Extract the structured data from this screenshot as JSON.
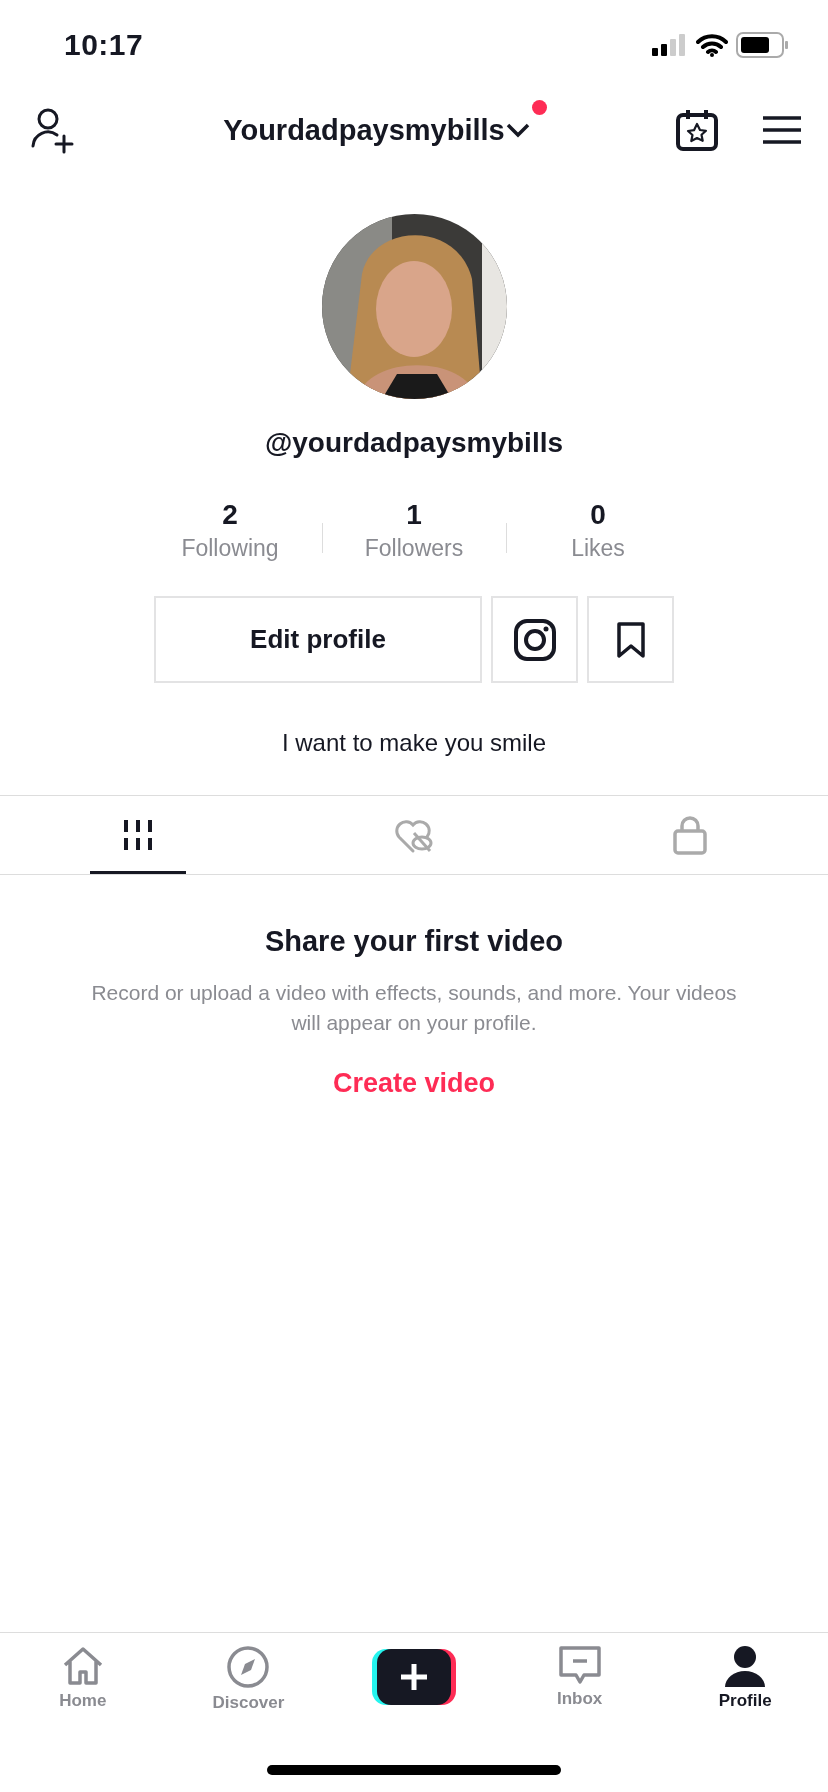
{
  "status_bar": {
    "time": "10:17"
  },
  "header": {
    "username": "Yourdadpaysmybills",
    "notification_dot": true
  },
  "profile": {
    "handle": "@yourdadpaysmybills",
    "stats": [
      {
        "value": "2",
        "label": "Following"
      },
      {
        "value": "1",
        "label": "Followers"
      },
      {
        "value": "0",
        "label": "Likes"
      }
    ],
    "edit_button": "Edit profile",
    "bio": "I want to make you smile"
  },
  "tabs": [
    {
      "kind": "videos",
      "selected": true
    },
    {
      "kind": "liked",
      "selected": false
    },
    {
      "kind": "private",
      "selected": false
    }
  ],
  "empty_state": {
    "title": "Share your first video",
    "text": "Record or upload a video with effects, sounds, and more. Your videos will appear on your profile.",
    "link": "Create video"
  },
  "bottom_nav": [
    {
      "kind": "home",
      "label": "Home",
      "selected": false
    },
    {
      "kind": "discover",
      "label": "Discover",
      "selected": false
    },
    {
      "kind": "create"
    },
    {
      "kind": "inbox",
      "label": "Inbox",
      "selected": false
    },
    {
      "kind": "profile",
      "label": "Profile",
      "selected": true
    }
  ]
}
